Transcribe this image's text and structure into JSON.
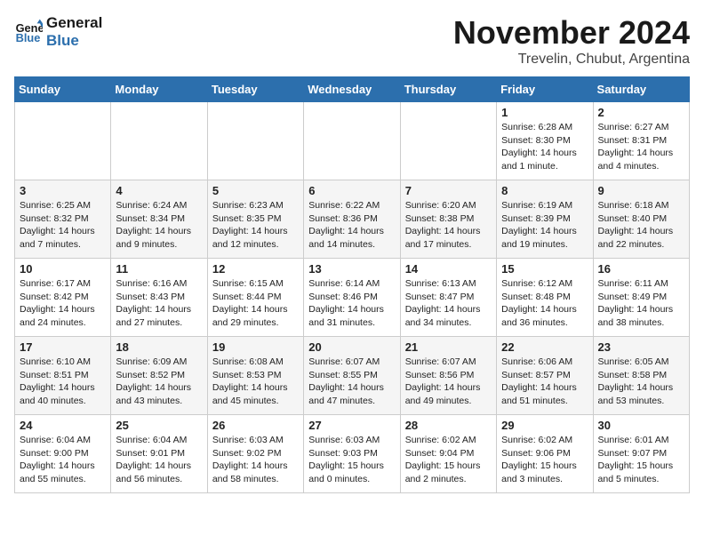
{
  "logo": {
    "text_general": "General",
    "text_blue": "Blue"
  },
  "title": {
    "month_year": "November 2024",
    "location": "Trevelin, Chubut, Argentina"
  },
  "header": {
    "days": [
      "Sunday",
      "Monday",
      "Tuesday",
      "Wednesday",
      "Thursday",
      "Friday",
      "Saturday"
    ]
  },
  "weeks": [
    [
      {
        "day": "",
        "info": ""
      },
      {
        "day": "",
        "info": ""
      },
      {
        "day": "",
        "info": ""
      },
      {
        "day": "",
        "info": ""
      },
      {
        "day": "",
        "info": ""
      },
      {
        "day": "1",
        "info": "Sunrise: 6:28 AM\nSunset: 8:30 PM\nDaylight: 14 hours and 1 minute."
      },
      {
        "day": "2",
        "info": "Sunrise: 6:27 AM\nSunset: 8:31 PM\nDaylight: 14 hours and 4 minutes."
      }
    ],
    [
      {
        "day": "3",
        "info": "Sunrise: 6:25 AM\nSunset: 8:32 PM\nDaylight: 14 hours and 7 minutes."
      },
      {
        "day": "4",
        "info": "Sunrise: 6:24 AM\nSunset: 8:34 PM\nDaylight: 14 hours and 9 minutes."
      },
      {
        "day": "5",
        "info": "Sunrise: 6:23 AM\nSunset: 8:35 PM\nDaylight: 14 hours and 12 minutes."
      },
      {
        "day": "6",
        "info": "Sunrise: 6:22 AM\nSunset: 8:36 PM\nDaylight: 14 hours and 14 minutes."
      },
      {
        "day": "7",
        "info": "Sunrise: 6:20 AM\nSunset: 8:38 PM\nDaylight: 14 hours and 17 minutes."
      },
      {
        "day": "8",
        "info": "Sunrise: 6:19 AM\nSunset: 8:39 PM\nDaylight: 14 hours and 19 minutes."
      },
      {
        "day": "9",
        "info": "Sunrise: 6:18 AM\nSunset: 8:40 PM\nDaylight: 14 hours and 22 minutes."
      }
    ],
    [
      {
        "day": "10",
        "info": "Sunrise: 6:17 AM\nSunset: 8:42 PM\nDaylight: 14 hours and 24 minutes."
      },
      {
        "day": "11",
        "info": "Sunrise: 6:16 AM\nSunset: 8:43 PM\nDaylight: 14 hours and 27 minutes."
      },
      {
        "day": "12",
        "info": "Sunrise: 6:15 AM\nSunset: 8:44 PM\nDaylight: 14 hours and 29 minutes."
      },
      {
        "day": "13",
        "info": "Sunrise: 6:14 AM\nSunset: 8:46 PM\nDaylight: 14 hours and 31 minutes."
      },
      {
        "day": "14",
        "info": "Sunrise: 6:13 AM\nSunset: 8:47 PM\nDaylight: 14 hours and 34 minutes."
      },
      {
        "day": "15",
        "info": "Sunrise: 6:12 AM\nSunset: 8:48 PM\nDaylight: 14 hours and 36 minutes."
      },
      {
        "day": "16",
        "info": "Sunrise: 6:11 AM\nSunset: 8:49 PM\nDaylight: 14 hours and 38 minutes."
      }
    ],
    [
      {
        "day": "17",
        "info": "Sunrise: 6:10 AM\nSunset: 8:51 PM\nDaylight: 14 hours and 40 minutes."
      },
      {
        "day": "18",
        "info": "Sunrise: 6:09 AM\nSunset: 8:52 PM\nDaylight: 14 hours and 43 minutes."
      },
      {
        "day": "19",
        "info": "Sunrise: 6:08 AM\nSunset: 8:53 PM\nDaylight: 14 hours and 45 minutes."
      },
      {
        "day": "20",
        "info": "Sunrise: 6:07 AM\nSunset: 8:55 PM\nDaylight: 14 hours and 47 minutes."
      },
      {
        "day": "21",
        "info": "Sunrise: 6:07 AM\nSunset: 8:56 PM\nDaylight: 14 hours and 49 minutes."
      },
      {
        "day": "22",
        "info": "Sunrise: 6:06 AM\nSunset: 8:57 PM\nDaylight: 14 hours and 51 minutes."
      },
      {
        "day": "23",
        "info": "Sunrise: 6:05 AM\nSunset: 8:58 PM\nDaylight: 14 hours and 53 minutes."
      }
    ],
    [
      {
        "day": "24",
        "info": "Sunrise: 6:04 AM\nSunset: 9:00 PM\nDaylight: 14 hours and 55 minutes."
      },
      {
        "day": "25",
        "info": "Sunrise: 6:04 AM\nSunset: 9:01 PM\nDaylight: 14 hours and 56 minutes."
      },
      {
        "day": "26",
        "info": "Sunrise: 6:03 AM\nSunset: 9:02 PM\nDaylight: 14 hours and 58 minutes."
      },
      {
        "day": "27",
        "info": "Sunrise: 6:03 AM\nSunset: 9:03 PM\nDaylight: 15 hours and 0 minutes."
      },
      {
        "day": "28",
        "info": "Sunrise: 6:02 AM\nSunset: 9:04 PM\nDaylight: 15 hours and 2 minutes."
      },
      {
        "day": "29",
        "info": "Sunrise: 6:02 AM\nSunset: 9:06 PM\nDaylight: 15 hours and 3 minutes."
      },
      {
        "day": "30",
        "info": "Sunrise: 6:01 AM\nSunset: 9:07 PM\nDaylight: 15 hours and 5 minutes."
      }
    ]
  ]
}
